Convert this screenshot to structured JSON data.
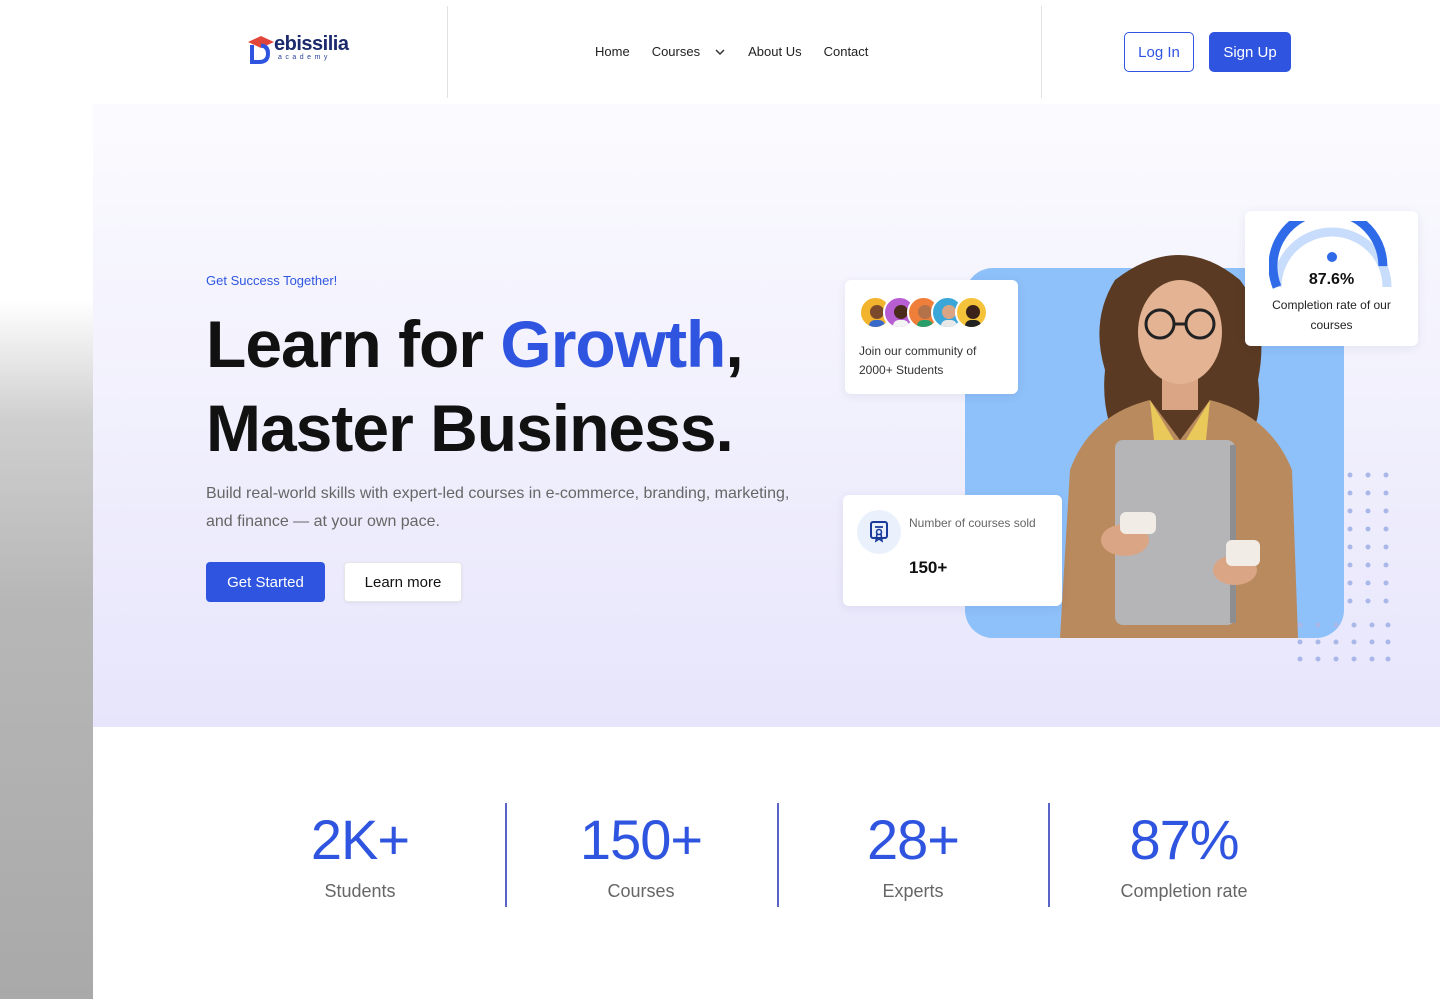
{
  "header": {
    "logo": {
      "name": "ebissilia",
      "sub": "academy"
    },
    "nav": [
      {
        "label": "Home"
      },
      {
        "label": "Courses",
        "has_dropdown": true,
        "icon": "chevron-down-icon"
      },
      {
        "label": "About Us"
      },
      {
        "label": "Contact"
      }
    ],
    "login_label": "Log In",
    "signup_label": "Sign Up"
  },
  "hero": {
    "tagline": "Get Success Together!",
    "headline_part1": "Learn for ",
    "headline_accent": "Growth",
    "headline_part2": ",",
    "headline_line2": "Master Business.",
    "subtext": "Build real-world skills with expert-led courses in e-commerce, branding, marketing, and finance — at your own pace.",
    "primary_cta": "Get Started",
    "secondary_cta": "Learn more"
  },
  "cards": {
    "community": {
      "text": "Join our community of 2000+ Students"
    },
    "courses_sold": {
      "label": "Number of courses sold",
      "value": "150+",
      "icon": "certificate-icon"
    },
    "completion": {
      "value": "87.6%",
      "percent": 87.6,
      "label": "Completion rate of our courses"
    }
  },
  "stats": [
    {
      "value": "2K+",
      "label": "Students"
    },
    {
      "value": "150+",
      "label": "Courses"
    },
    {
      "value": "28+",
      "label": "Experts"
    },
    {
      "value": "87%",
      "label": "Completion rate"
    }
  ],
  "colors": {
    "accent": "#2f55e0",
    "hero_block": "#8ec0f9",
    "logo_cap": "#e2463b"
  }
}
